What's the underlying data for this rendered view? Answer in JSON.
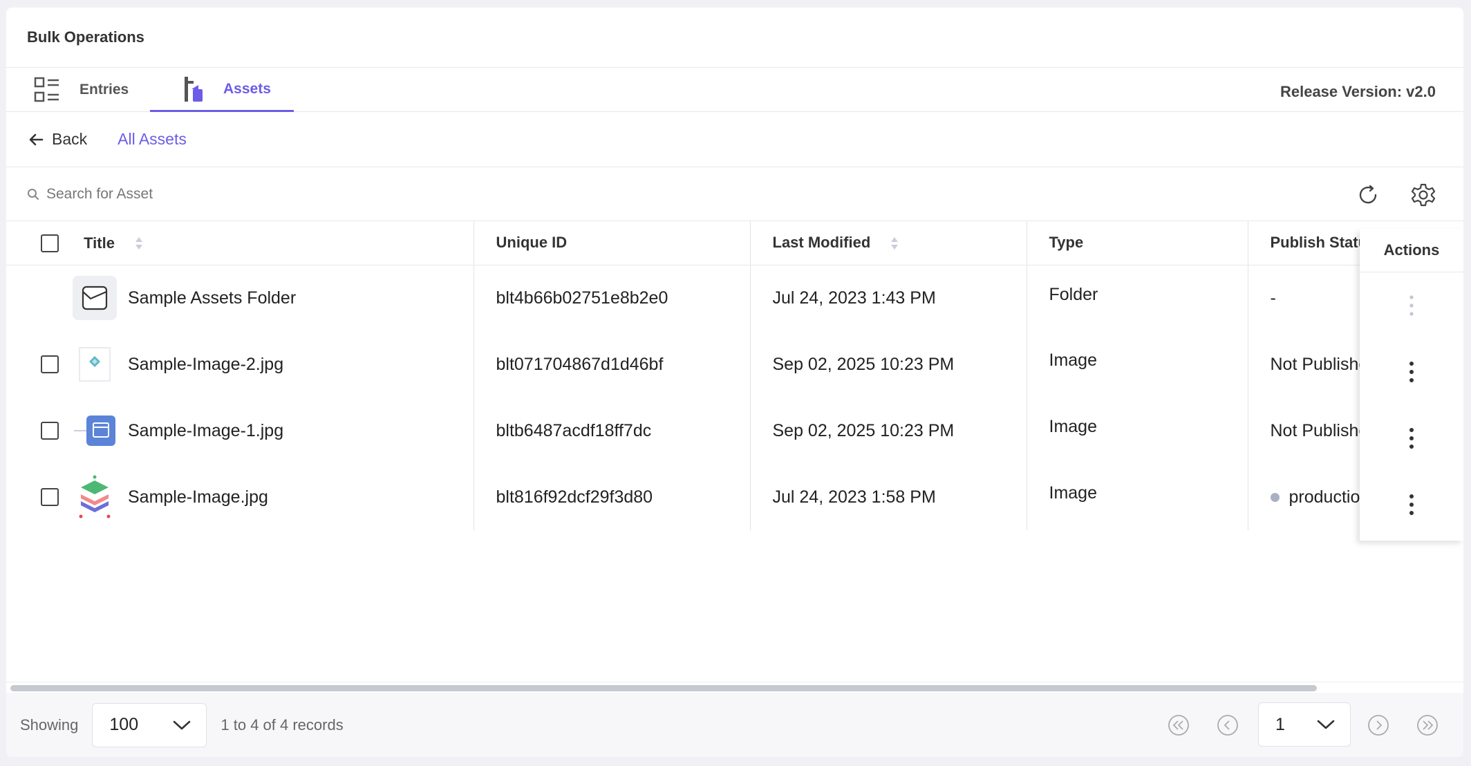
{
  "header": {
    "title": "Bulk Operations"
  },
  "tabs": [
    {
      "label": "Entries"
    },
    {
      "label": "Assets"
    }
  ],
  "release": "Release Version: v2.0",
  "breadcrumb": {
    "back": "Back",
    "current": "All Assets"
  },
  "search": {
    "placeholder": "Search for Asset"
  },
  "table": {
    "columns": {
      "title": "Title",
      "uid": "Unique ID",
      "modified": "Last Modified",
      "type": "Type",
      "status": "Publish Status",
      "actions": "Actions"
    },
    "rows": [
      {
        "title": "Sample Assets Folder",
        "uid": "blt4b66b02751e8b2e0",
        "modified": "Jul 24, 2023 1:43 PM",
        "type": "Folder",
        "status": "-"
      },
      {
        "title": "Sample-Image-2.jpg",
        "uid": "blt071704867d1d46bf",
        "modified": "Sep 02, 2025 10:23 PM",
        "type": "Image",
        "status": "Not Published"
      },
      {
        "title": "Sample-Image-1.jpg",
        "uid": "bltb6487acdf18ff7dc",
        "modified": "Sep 02, 2025 10:23 PM",
        "type": "Image",
        "status": "Not Published"
      },
      {
        "title": "Sample-Image.jpg",
        "uid": "blt816f92dcf29f3d80",
        "modified": "Jul 24, 2023 1:58 PM",
        "type": "Image",
        "status": "production"
      }
    ]
  },
  "footer": {
    "showing": "Showing",
    "page_size": "100",
    "records": "1 to 4 of 4 records",
    "page": "1"
  },
  "colors": {
    "accent": "#6c5ce7",
    "status_dot": "#a9b0c0"
  }
}
